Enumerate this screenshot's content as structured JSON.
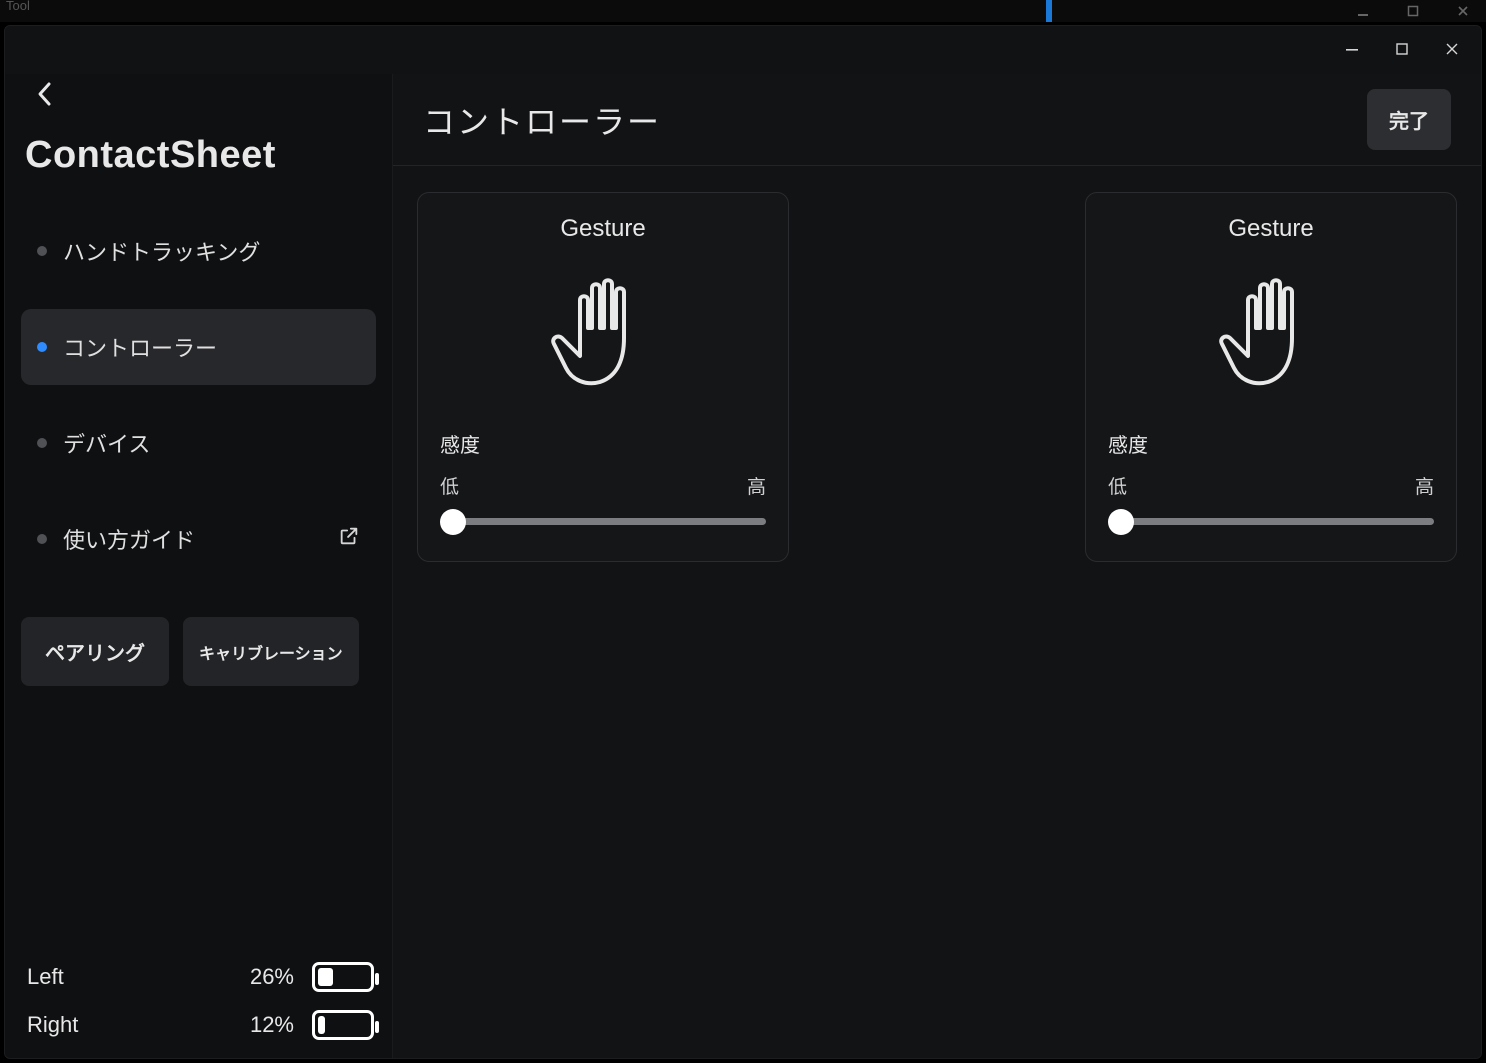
{
  "topstrip": {
    "tool_text": "Tool"
  },
  "sidebar": {
    "logo": "ContactSheet",
    "nav": [
      {
        "label": "ハンドトラッキング",
        "active": false,
        "external": false
      },
      {
        "label": "コントローラー",
        "active": true,
        "external": false
      },
      {
        "label": "デバイス",
        "active": false,
        "external": false
      },
      {
        "label": "使い方ガイド",
        "active": false,
        "external": true
      }
    ],
    "buttons": {
      "pairing": "ペアリング",
      "calibration": "キャリブレーション"
    },
    "battery": {
      "left": {
        "label": "Left",
        "percent_text": "26%",
        "percent": 26
      },
      "right": {
        "label": "Right",
        "percent_text": "12%",
        "percent": 12
      }
    }
  },
  "main": {
    "title": "コントローラー",
    "done_label": "完了",
    "cards": [
      {
        "title": "Gesture",
        "sensitivity_label": "感度",
        "low_label": "低",
        "high_label": "高",
        "slider_value": 0
      },
      {
        "title": "Gesture",
        "sensitivity_label": "感度",
        "low_label": "低",
        "high_label": "高",
        "slider_value": 0
      }
    ]
  }
}
